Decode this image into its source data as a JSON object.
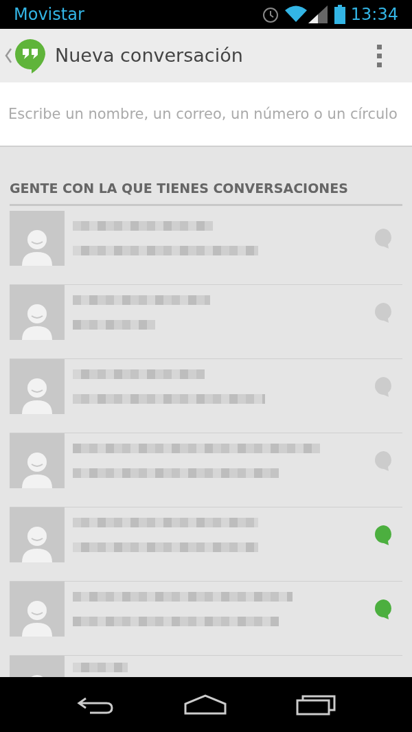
{
  "status_bar": {
    "carrier": "Movistar",
    "time": "13:34"
  },
  "action_bar": {
    "title": "Nueva conversación"
  },
  "search": {
    "placeholder": "Escribe un nombre, un correo, un número o un círculo"
  },
  "section": {
    "title": "GENTE CON LA QUE TIENES CONVERSACIONES"
  },
  "contacts": [
    {
      "kind": "contact",
      "online": false
    },
    {
      "kind": "contact",
      "online": false
    },
    {
      "kind": "contact",
      "online": false
    },
    {
      "kind": "contact",
      "online": false
    },
    {
      "kind": "contact",
      "online": true
    },
    {
      "kind": "contact",
      "online": true
    },
    {
      "kind": "partial"
    }
  ]
}
